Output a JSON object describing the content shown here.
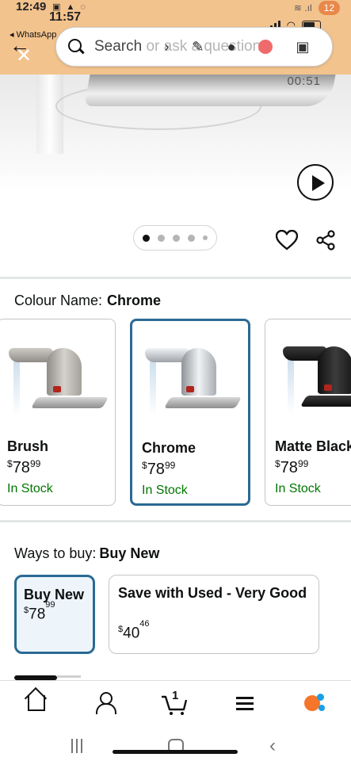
{
  "status_bar": {
    "android_time": "12:49",
    "ios_time": "11:57",
    "back_app": "◂ WhatsApp",
    "battery": "12"
  },
  "search": {
    "placeholder": "Search or ask a question"
  },
  "media": {
    "video_time": "00:51",
    "image_count": 5,
    "active_index": 0
  },
  "colour": {
    "label": "Colour Name:",
    "selected": "Chrome",
    "options": [
      {
        "name": "Brush",
        "currency": "$",
        "whole": "78",
        "fraction": "99",
        "stock": "In Stock",
        "finish": "#b9b6b1"
      },
      {
        "name": "Chrome",
        "currency": "$",
        "whole": "78",
        "fraction": "99",
        "stock": "In Stock",
        "finish": "#d9dcdf"
      },
      {
        "name": "Matte Black",
        "currency": "$",
        "whole": "78",
        "fraction": "99",
        "stock": "In Stock",
        "finish": "#1c1c1e"
      }
    ]
  },
  "ways_to_buy": {
    "label": "Ways to buy:",
    "selected": "Buy New",
    "options": [
      {
        "name": "Buy New",
        "currency": "$",
        "whole": "78",
        "fraction": "99"
      },
      {
        "name": "Save with Used - Very Good",
        "currency": "$",
        "whole": "40",
        "fraction": "46"
      }
    ]
  },
  "bottom_nav": {
    "cart_count": "1",
    "items": [
      "home-icon",
      "account-icon",
      "cart-icon",
      "menu-icon",
      "rufus-ai-icon"
    ]
  },
  "colors": {
    "header_bg": "#f3c38e",
    "selected_border": "#2a6a94",
    "in_stock": "#007600"
  }
}
